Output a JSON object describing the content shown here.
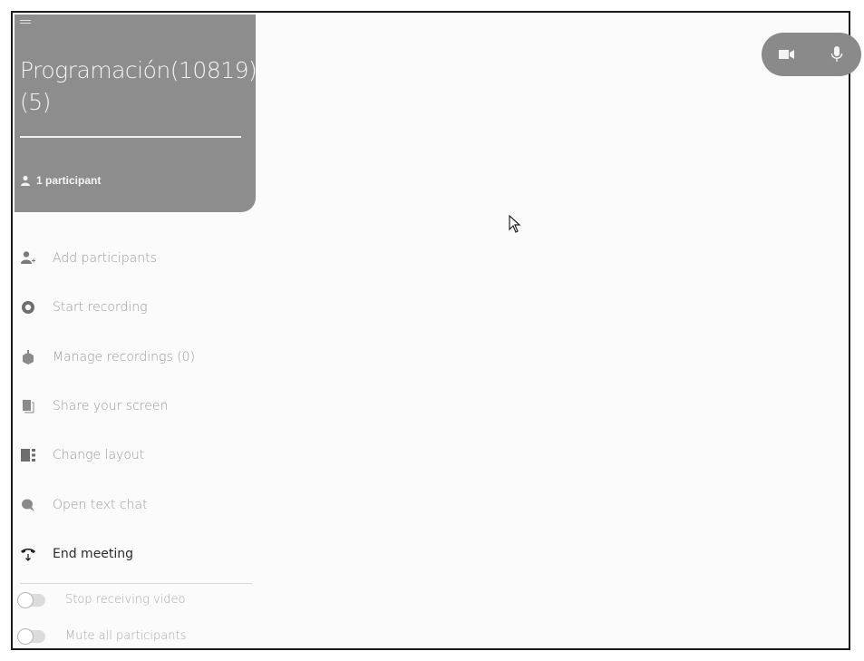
{
  "header": {
    "title": "Programación(10819)(5)",
    "participants_label": "1 participant"
  },
  "menu": {
    "items": [
      {
        "label": "Add participants",
        "icon": "add-participant-icon"
      },
      {
        "label": "Start recording",
        "icon": "record-icon"
      },
      {
        "label": "Manage recordings (0)",
        "icon": "recordings-icon"
      },
      {
        "label": "Share your screen",
        "icon": "screen-share-icon"
      },
      {
        "label": "Change layout",
        "icon": "layout-icon"
      },
      {
        "label": "Open text chat",
        "icon": "chat-icon"
      },
      {
        "label": "End meeting",
        "icon": "end-call-icon"
      }
    ]
  },
  "toggles": [
    {
      "label": "Stop receiving video",
      "on": false
    },
    {
      "label": "Mute all participants",
      "on": false
    }
  ],
  "media_controls": {
    "camera_icon": "camera-icon",
    "mic_icon": "microphone-icon"
  },
  "colors": {
    "header_bg": "#8d8d8d",
    "pill_bg": "#8a8a8a",
    "menu_text": "#9a9a9a",
    "strong_text": "#2b2b2b"
  }
}
